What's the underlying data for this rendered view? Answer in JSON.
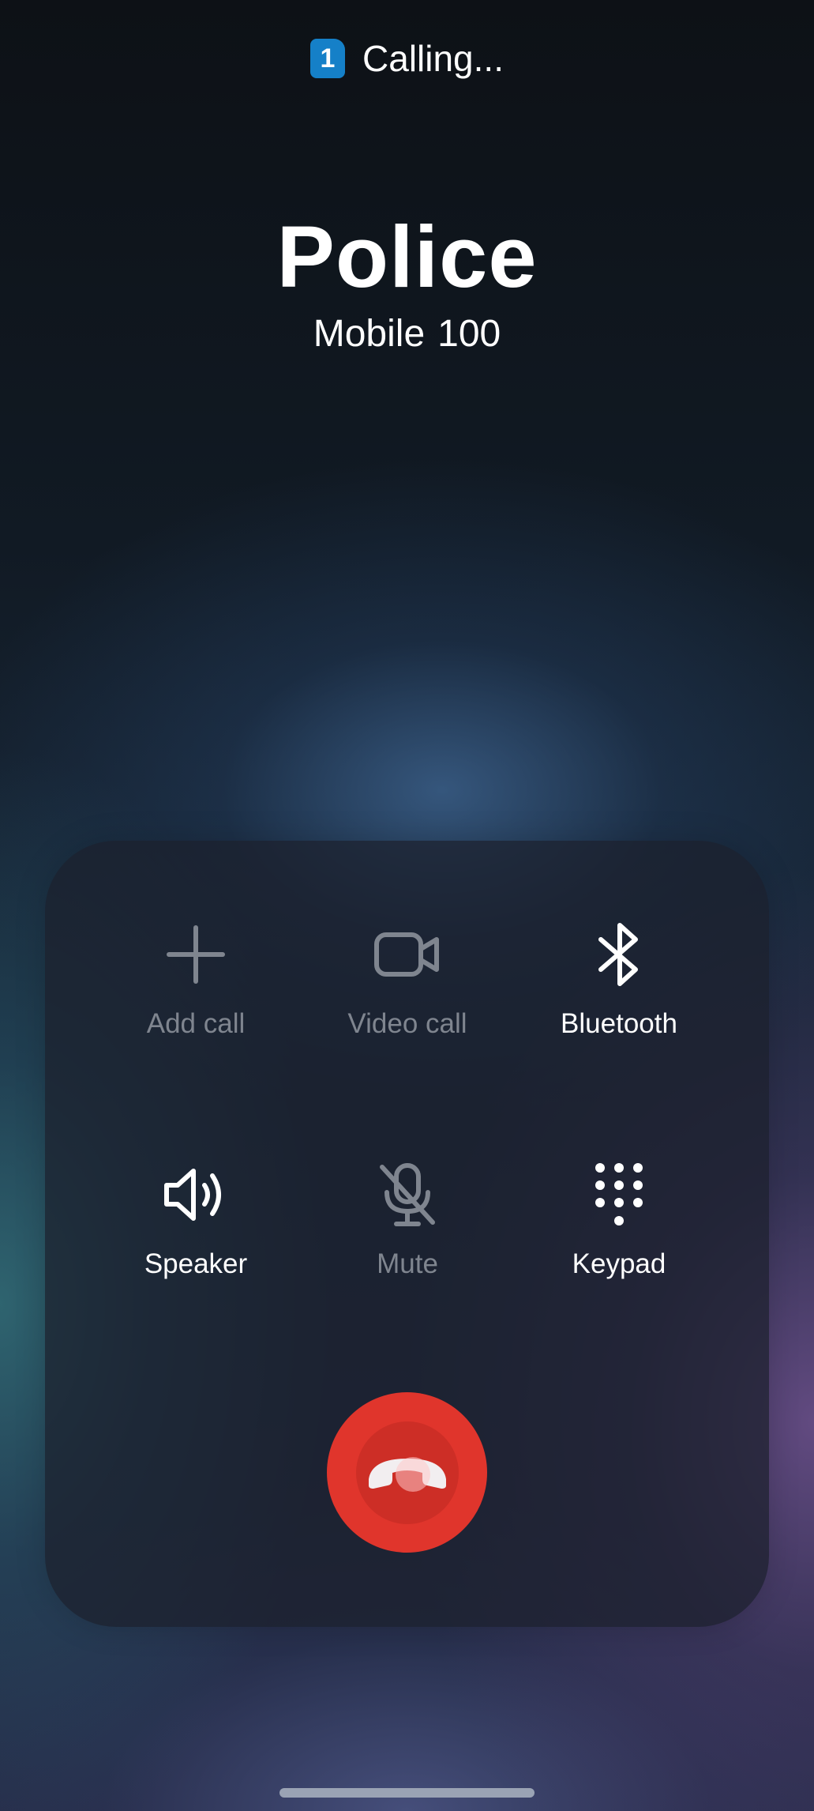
{
  "status": {
    "sim_number": "1",
    "sim_color": "#1580c8",
    "text": "Calling..."
  },
  "contact": {
    "name": "Police",
    "type": "Mobile",
    "number": "100"
  },
  "controls": [
    {
      "label": "Add call",
      "icon": "plus-icon",
      "enabled": false
    },
    {
      "label": "Video call",
      "icon": "video-camera-icon",
      "enabled": false
    },
    {
      "label": "Bluetooth",
      "icon": "bluetooth-icon",
      "enabled": true
    },
    {
      "label": "Speaker",
      "icon": "speaker-icon",
      "enabled": true
    },
    {
      "label": "Mute",
      "icon": "microphone-off-icon",
      "enabled": false
    },
    {
      "label": "Keypad",
      "icon": "keypad-icon",
      "enabled": true
    }
  ],
  "end_call": {
    "icon": "phone-hangup-icon",
    "color": "#e0352c"
  }
}
